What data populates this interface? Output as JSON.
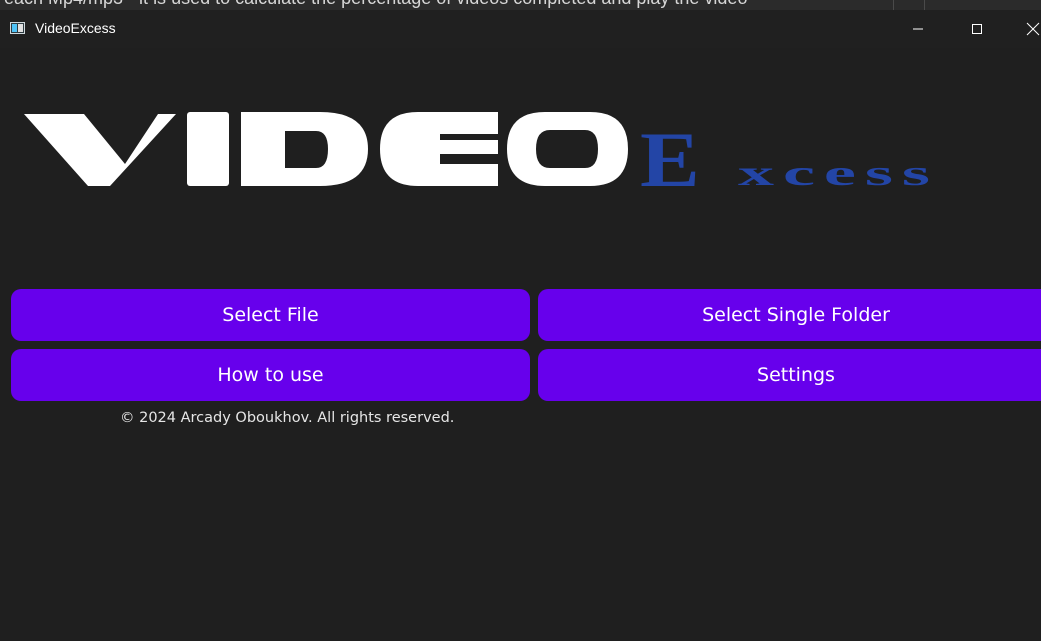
{
  "background_window": {
    "text": "each Mp4/mp3 - it is used to calculate the percentage of videos completed and play the video"
  },
  "window": {
    "title": "VideoExcess",
    "icon": "app-icon",
    "controls": {
      "minimize_icon": "minimize-icon",
      "maximize_icon": "maximize-icon",
      "close_icon": "close-icon"
    }
  },
  "logo": {
    "part1": "VIDEO",
    "part2_big": "E",
    "part2_rest": "xcess",
    "part1_color": "#ffffff",
    "part2_color": "#2345a6"
  },
  "buttons": {
    "select_file": "Select File",
    "select_folder": "Select Single Folder",
    "how_to_use": "How to use",
    "settings": "Settings"
  },
  "footer": {
    "copyright": "© 2024 Arcady Oboukhov. All rights reserved."
  },
  "colors": {
    "accent": "#6700ec",
    "background": "#1f1f1f",
    "titlebar": "#202020"
  }
}
